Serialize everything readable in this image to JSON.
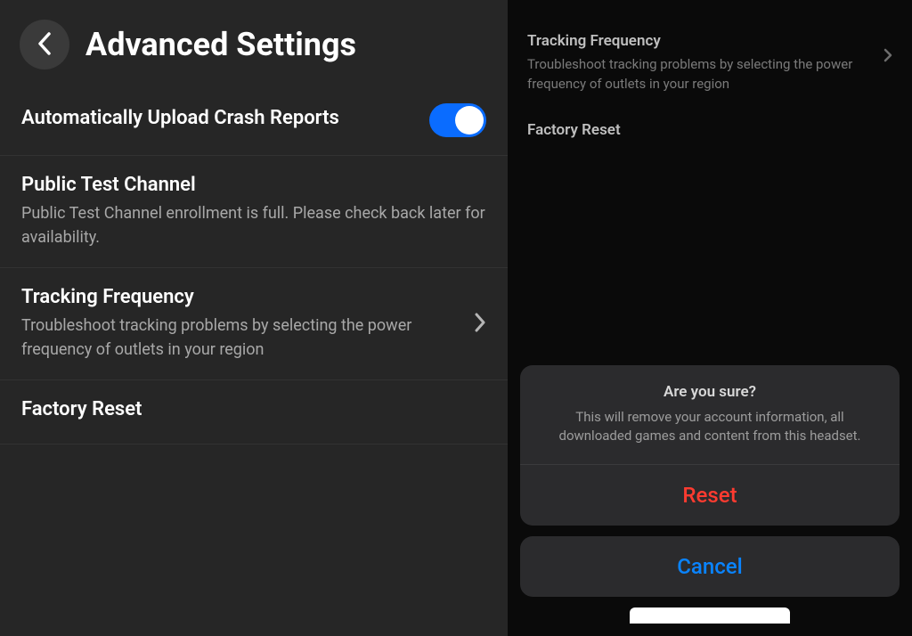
{
  "header": {
    "title": "Advanced Settings"
  },
  "settings": {
    "crash_reports": {
      "title": "Automatically Upload Crash Reports"
    },
    "public_test": {
      "title": "Public Test Channel",
      "desc": "Public Test Channel enrollment is full. Please check back later for availability."
    },
    "tracking": {
      "title": "Tracking Frequency",
      "desc": "Troubleshoot tracking problems by selecting the power frequency of outlets in your region"
    },
    "factory_reset": {
      "title": "Factory Reset"
    }
  },
  "right": {
    "tracking": {
      "title": "Tracking Frequency",
      "desc": "Troubleshoot tracking problems by selecting the power frequency of outlets in your region"
    },
    "factory_reset": {
      "title": "Factory Reset"
    }
  },
  "dialog": {
    "title": "Are you sure?",
    "message": "This will remove your account information, all downloaded games and content from this headset.",
    "reset_label": "Reset",
    "cancel_label": "Cancel"
  },
  "colors": {
    "toggle_on": "#0a6cff",
    "destructive": "#ff3b30",
    "link": "#0a84ff"
  }
}
